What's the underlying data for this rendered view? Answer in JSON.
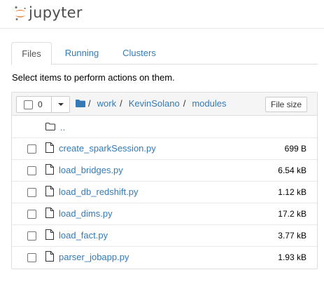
{
  "header": {
    "logo_text": "jupyter"
  },
  "tabs": [
    {
      "label": "Files",
      "active": true
    },
    {
      "label": "Running",
      "active": false
    },
    {
      "label": "Clusters",
      "active": false
    }
  ],
  "instructions": "Select items to perform actions on them.",
  "toolbar": {
    "selected_count": "0",
    "breadcrumb": [
      "work",
      "KevinSolano",
      "modules"
    ],
    "breadcrumb_separator": "/",
    "sort_button_label": "File size"
  },
  "parent_dir": {
    "label": ".."
  },
  "files": [
    {
      "name": "create_sparkSession.py",
      "size": "699 B"
    },
    {
      "name": "load_bridges.py",
      "size": "6.54 kB"
    },
    {
      "name": "load_db_redshift.py",
      "size": "1.12 kB"
    },
    {
      "name": "load_dims.py",
      "size": "17.2 kB"
    },
    {
      "name": "load_fact.py",
      "size": "3.77 kB"
    },
    {
      "name": "parser_jobapp.py",
      "size": "1.93 kB"
    }
  ],
  "colors": {
    "link": "#337ab7",
    "logo_orange": "#f37626",
    "logo_gray": "#4e4e4e"
  }
}
